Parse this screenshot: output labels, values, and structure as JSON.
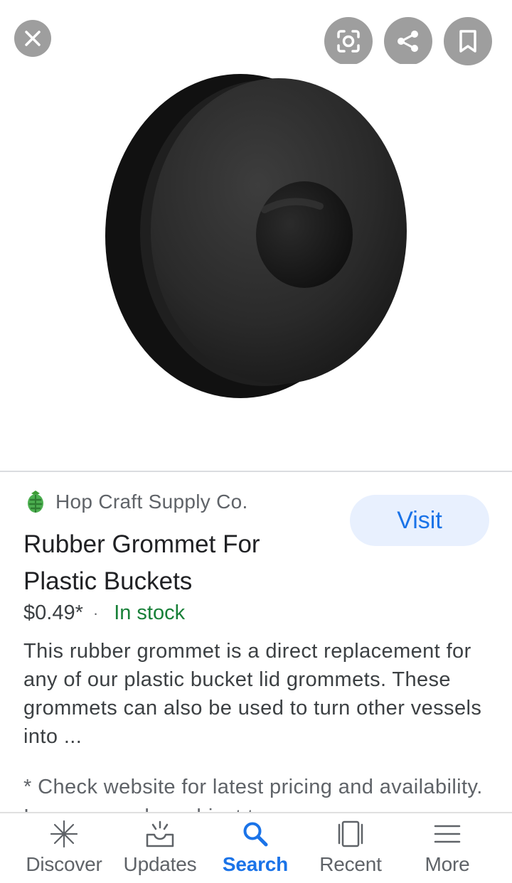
{
  "product": {
    "source": "Hop Craft Supply Co.",
    "title": "Rubber Grommet For Plastic Buckets",
    "price": "$0.49*",
    "separator": "·",
    "availability": "In stock",
    "description": "This rubber grommet is a direct replacement for any of our plastic bucket lid grommets. These grommets can also be used to turn other vessels into ...",
    "disclaimer": "* Check website for latest pricing and availability. Images may be subject to",
    "visit_label": "Visit"
  },
  "top_buttons": {
    "close": "close-icon",
    "lens": "lens-icon",
    "share": "share-icon",
    "save": "bookmark-icon"
  },
  "nav": {
    "items": [
      {
        "label": "Discover",
        "icon": "discover-icon"
      },
      {
        "label": "Updates",
        "icon": "updates-icon"
      },
      {
        "label": "Search",
        "icon": "search-icon",
        "active": true
      },
      {
        "label": "Recent",
        "icon": "recent-icon"
      },
      {
        "label": "More",
        "icon": "menu-icon"
      }
    ]
  },
  "colors": {
    "accent": "#1a73e8",
    "in_stock": "#188038",
    "button_gray": "#9e9e9e",
    "visit_bg": "#e8f0fe"
  }
}
